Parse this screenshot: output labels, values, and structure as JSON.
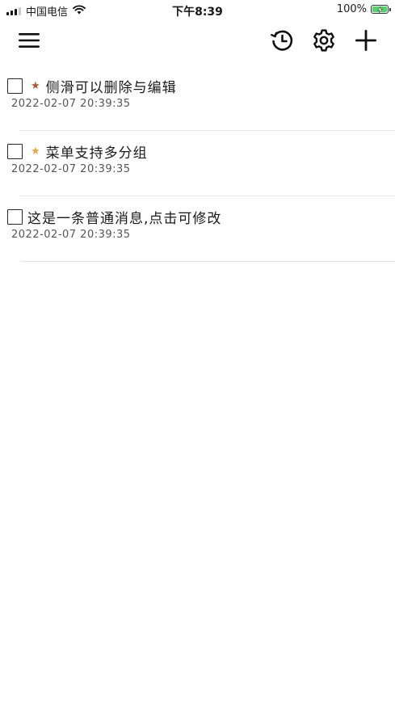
{
  "status_bar": {
    "carrier": "中国电信",
    "time": "下午8:39",
    "battery": "100%"
  },
  "nav": {
    "menu_icon": "hamburger-menu-icon",
    "history_icon": "history-clock-icon",
    "settings_icon": "gear-icon",
    "add_icon": "plus-icon"
  },
  "items": [
    {
      "title": "侧滑可以删除与编辑",
      "date": "2022-02-07 20:39:35",
      "starred": true,
      "star_color": "#b5542a",
      "checked": false
    },
    {
      "title": "菜单支持多分组",
      "date": "2022-02-07 20:39:35",
      "starred": true,
      "star_color": "#f0a63a",
      "checked": false
    },
    {
      "title": "这是一条普通消息,点击可修改",
      "date": "2022-02-07 20:39:35",
      "starred": false,
      "checked": false
    }
  ],
  "colors": {
    "battery_green": "#4cd964",
    "divider": "#e4e4e4"
  }
}
